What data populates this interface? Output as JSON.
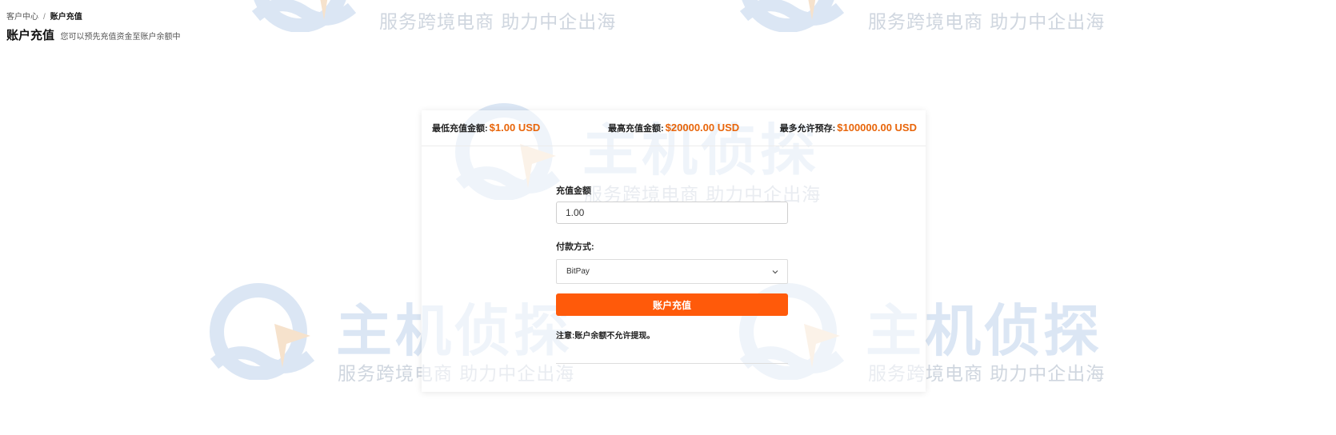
{
  "breadcrumb": {
    "items": [
      "客户中心",
      "账户充值"
    ],
    "separator": "/"
  },
  "header": {
    "title": "账户充值",
    "subtitle": "您可以预先充值资金至账户余额中"
  },
  "limits": {
    "min_label": "最低充值金额:",
    "min_value": "$1.00 USD",
    "max_label": "最高充值金额:",
    "max_value": "$20000.00 USD",
    "prepay_label": "最多允许预存:",
    "prepay_value": "$100000.00 USD"
  },
  "form": {
    "amount_label": "充值金额",
    "amount_value": "1.00",
    "payment_label": "付款方式:",
    "payment_selected": "BitPay",
    "submit_label": "账户充值",
    "notice": "注意:账户余额不允许提现。"
  },
  "watermark": {
    "brand": "主机侦探",
    "slogan": "服务跨境电商 助力中企出海"
  },
  "colors": {
    "accent": "#ff5a0a",
    "value_orange": "#e8650a",
    "watermark_blue": "#dbe6f4"
  },
  "icons": {
    "select_arrow": "chevron-down-icon",
    "watermark_logo": "detective-logo-icon"
  }
}
